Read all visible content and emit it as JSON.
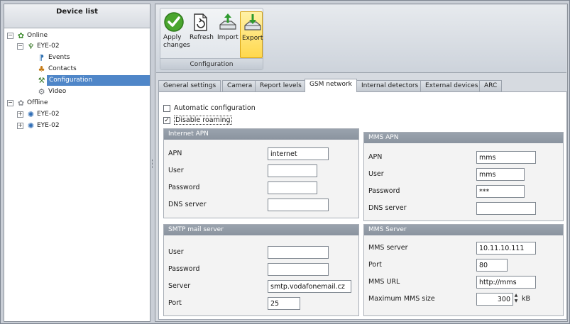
{
  "device_list": {
    "title": "Device list",
    "online_label": "Online",
    "online_device": "EYE-02",
    "events_label": "Events",
    "contacts_label": "Contacts",
    "configuration_label": "Configuration",
    "video_label": "Video",
    "offline_label": "Offline",
    "offline_devices": [
      "EYE-02",
      "EYE-02"
    ]
  },
  "toolbar": {
    "apply_label": "Apply changes",
    "refresh_label": "Refresh",
    "import_label": "Import",
    "export_label": "Export",
    "group_caption": "Configuration"
  },
  "tabs": [
    "General settings",
    "Camera",
    "Report levels",
    "GSM network",
    "Internal detectors",
    "External devices",
    "ARC"
  ],
  "active_tab": "GSM network",
  "options": {
    "automatic_configuration": {
      "label": "Automatic configuration",
      "checked": false
    },
    "disable_roaming": {
      "label": "Disable roaming",
      "checked": true
    }
  },
  "internet_apn": {
    "title": "Internet APN",
    "apn_label": "APN",
    "apn_value": "internet",
    "user_label": "User",
    "user_value": "",
    "password_label": "Password",
    "password_value": "",
    "dns_label": "DNS server",
    "dns_value": ""
  },
  "mms_apn": {
    "title": "MMS APN",
    "apn_label": "APN",
    "apn_value": "mms",
    "user_label": "User",
    "user_value": "mms",
    "password_label": "Password",
    "password_value": "***",
    "dns_label": "DNS server",
    "dns_value": ""
  },
  "smtp": {
    "title": "SMTP mail server",
    "user_label": "User",
    "user_value": "",
    "password_label": "Password",
    "password_value": "",
    "server_label": "Server",
    "server_value": "smtp.vodafonemail.cz",
    "port_label": "Port",
    "port_value": "25"
  },
  "mms_server": {
    "title": "MMS Server",
    "server_label": "MMS server",
    "server_value": "10.11.10.111",
    "port_label": "Port",
    "port_value": "80",
    "url_label": "MMS URL",
    "url_value": "http://mms",
    "max_size_label": "Maximum MMS size",
    "max_size_value": "300",
    "max_size_unit": "kB"
  },
  "colors": {
    "selection": "#4f86c8",
    "panel_title": "#8f98a3",
    "active_tool": "#ffd84d"
  }
}
